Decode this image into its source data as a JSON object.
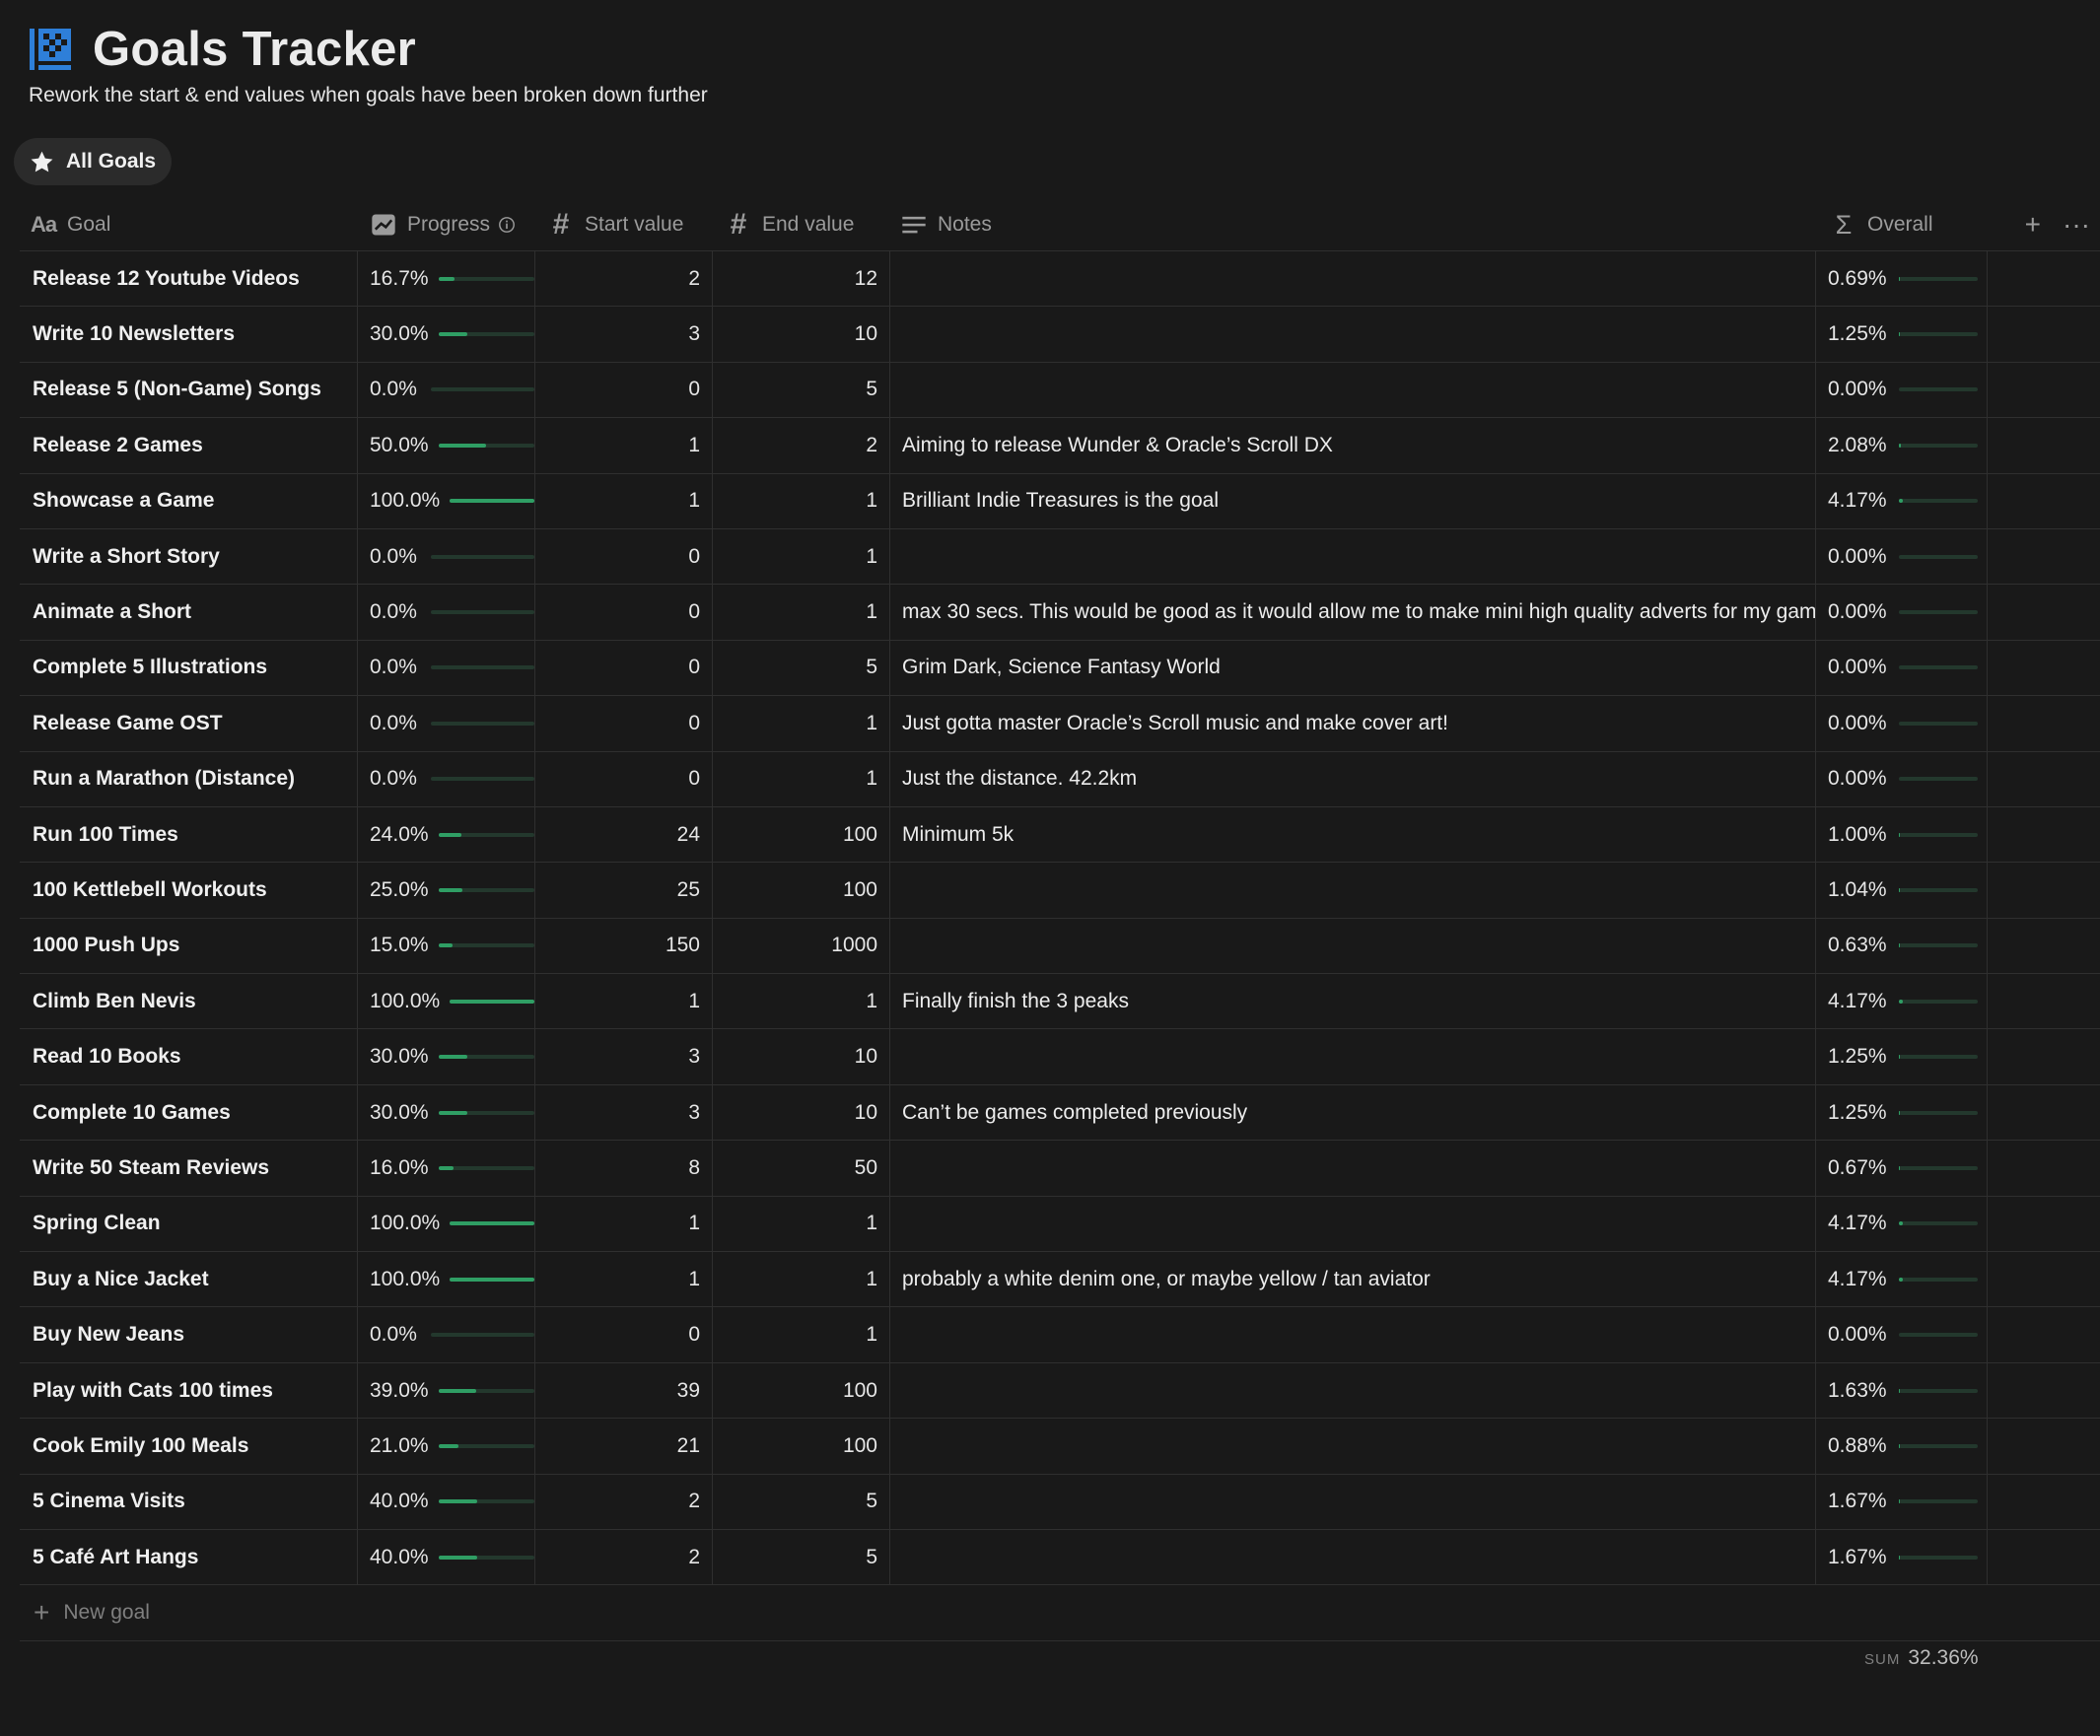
{
  "page": {
    "title": "Goals Tracker",
    "icon": "chart-grid-icon",
    "subtitle": "Rework the start & end values when goals have been broken down further"
  },
  "view_tab": {
    "label": "All Goals",
    "icon": "star-icon"
  },
  "columns": {
    "goal": {
      "label": "Goal",
      "icon": "text-type-icon"
    },
    "progress": {
      "label": "Progress",
      "icon": "progress-chart-icon"
    },
    "start": {
      "label": "Start value",
      "icon": "hash-icon"
    },
    "end": {
      "label": "End value",
      "icon": "hash-icon"
    },
    "notes": {
      "label": "Notes",
      "icon": "lines-icon"
    },
    "overall": {
      "label": "Overall",
      "icon": "sigma-icon"
    },
    "add": "+",
    "more": "···"
  },
  "rows": [
    {
      "goal": "Release 12 Youtube Videos",
      "progress": "16.7%",
      "progress_value": 0.167,
      "start": "2",
      "end": "12",
      "notes": "",
      "overall": "0.69%",
      "overall_value": 0.0069
    },
    {
      "goal": "Write 10 Newsletters",
      "progress": "30.0%",
      "progress_value": 0.3,
      "start": "3",
      "end": "10",
      "notes": "",
      "overall": "1.25%",
      "overall_value": 0.0125
    },
    {
      "goal": "Release 5 (Non-Game) Songs",
      "progress": "0.0%",
      "progress_value": 0,
      "start": "0",
      "end": "5",
      "notes": "",
      "overall": "0.00%",
      "overall_value": 0
    },
    {
      "goal": "Release 2 Games",
      "progress": "50.0%",
      "progress_value": 0.5,
      "start": "1",
      "end": "2",
      "notes": "Aiming to release Wunder & Oracle’s Scroll DX",
      "overall": "2.08%",
      "overall_value": 0.0208
    },
    {
      "goal": "Showcase a Game",
      "progress": "100.0%",
      "progress_value": 1.0,
      "start": "1",
      "end": "1",
      "notes": "Brilliant Indie Treasures is the goal",
      "overall": "4.17%",
      "overall_value": 0.0417
    },
    {
      "goal": "Write a Short Story",
      "progress": "0.0%",
      "progress_value": 0,
      "start": "0",
      "end": "1",
      "notes": "",
      "overall": "0.00%",
      "overall_value": 0
    },
    {
      "goal": "Animate a Short",
      "progress": "0.0%",
      "progress_value": 0,
      "start": "0",
      "end": "1",
      "notes": "max 30 secs. This would be good as it would allow me to make mini high quality adverts for my gam",
      "overall": "0.00%",
      "overall_value": 0
    },
    {
      "goal": "Complete 5 Illustrations",
      "progress": "0.0%",
      "progress_value": 0,
      "start": "0",
      "end": "5",
      "notes": "Grim Dark, Science Fantasy World",
      "overall": "0.00%",
      "overall_value": 0
    },
    {
      "goal": "Release Game OST",
      "progress": "0.0%",
      "progress_value": 0,
      "start": "0",
      "end": "1",
      "notes": "Just gotta master Oracle’s Scroll music and make cover art!",
      "overall": "0.00%",
      "overall_value": 0
    },
    {
      "goal": "Run a Marathon (Distance)",
      "progress": "0.0%",
      "progress_value": 0,
      "start": "0",
      "end": "1",
      "notes": "Just the distance. 42.2km",
      "overall": "0.00%",
      "overall_value": 0
    },
    {
      "goal": "Run 100 Times",
      "progress": "24.0%",
      "progress_value": 0.24,
      "start": "24",
      "end": "100",
      "notes": "Minimum 5k",
      "overall": "1.00%",
      "overall_value": 0.01
    },
    {
      "goal": "100 Kettlebell Workouts",
      "progress": "25.0%",
      "progress_value": 0.25,
      "start": "25",
      "end": "100",
      "notes": "",
      "overall": "1.04%",
      "overall_value": 0.0104
    },
    {
      "goal": "1000 Push Ups",
      "progress": "15.0%",
      "progress_value": 0.15,
      "start": "150",
      "end": "1000",
      "notes": "",
      "overall": "0.63%",
      "overall_value": 0.0063
    },
    {
      "goal": "Climb Ben Nevis",
      "progress": "100.0%",
      "progress_value": 1.0,
      "start": "1",
      "end": "1",
      "notes": "Finally finish the 3 peaks",
      "overall": "4.17%",
      "overall_value": 0.0417
    },
    {
      "goal": "Read 10 Books",
      "progress": "30.0%",
      "progress_value": 0.3,
      "start": "3",
      "end": "10",
      "notes": "",
      "overall": "1.25%",
      "overall_value": 0.0125
    },
    {
      "goal": "Complete 10 Games",
      "progress": "30.0%",
      "progress_value": 0.3,
      "start": "3",
      "end": "10",
      "notes": "Can’t be games completed previously",
      "overall": "1.25%",
      "overall_value": 0.0125
    },
    {
      "goal": "Write 50 Steam Reviews",
      "progress": "16.0%",
      "progress_value": 0.16,
      "start": "8",
      "end": "50",
      "notes": "",
      "overall": "0.67%",
      "overall_value": 0.0067
    },
    {
      "goal": "Spring Clean",
      "progress": "100.0%",
      "progress_value": 1.0,
      "start": "1",
      "end": "1",
      "notes": "",
      "overall": "4.17%",
      "overall_value": 0.0417
    },
    {
      "goal": "Buy a Nice Jacket",
      "progress": "100.0%",
      "progress_value": 1.0,
      "start": "1",
      "end": "1",
      "notes": "probably a white denim one, or maybe yellow / tan aviator",
      "overall": "4.17%",
      "overall_value": 0.0417
    },
    {
      "goal": "Buy New Jeans",
      "progress": "0.0%",
      "progress_value": 0,
      "start": "0",
      "end": "1",
      "notes": "",
      "overall": "0.00%",
      "overall_value": 0
    },
    {
      "goal": "Play with Cats 100 times",
      "progress": "39.0%",
      "progress_value": 0.39,
      "start": "39",
      "end": "100",
      "notes": "",
      "overall": "1.63%",
      "overall_value": 0.0163
    },
    {
      "goal": "Cook Emily 100 Meals",
      "progress": "21.0%",
      "progress_value": 0.21,
      "start": "21",
      "end": "100",
      "notes": "",
      "overall": "0.88%",
      "overall_value": 0.0088
    },
    {
      "goal": "5 Cinema Visits",
      "progress": "40.0%",
      "progress_value": 0.4,
      "start": "2",
      "end": "5",
      "notes": "",
      "overall": "1.67%",
      "overall_value": 0.0167
    },
    {
      "goal": "5 Café Art Hangs",
      "progress": "40.0%",
      "progress_value": 0.4,
      "start": "2",
      "end": "5",
      "notes": "",
      "overall": "1.67%",
      "overall_value": 0.0167
    }
  ],
  "new_row": {
    "label": "New goal",
    "icon": "plus-icon"
  },
  "footer": {
    "sum_label": "SUM",
    "sum_value": "32.36%"
  },
  "colors": {
    "background": "#191919",
    "bar_fill": "#2f9e64",
    "bar_track": "#23382d",
    "accent_icon": "#2e7fd9"
  }
}
